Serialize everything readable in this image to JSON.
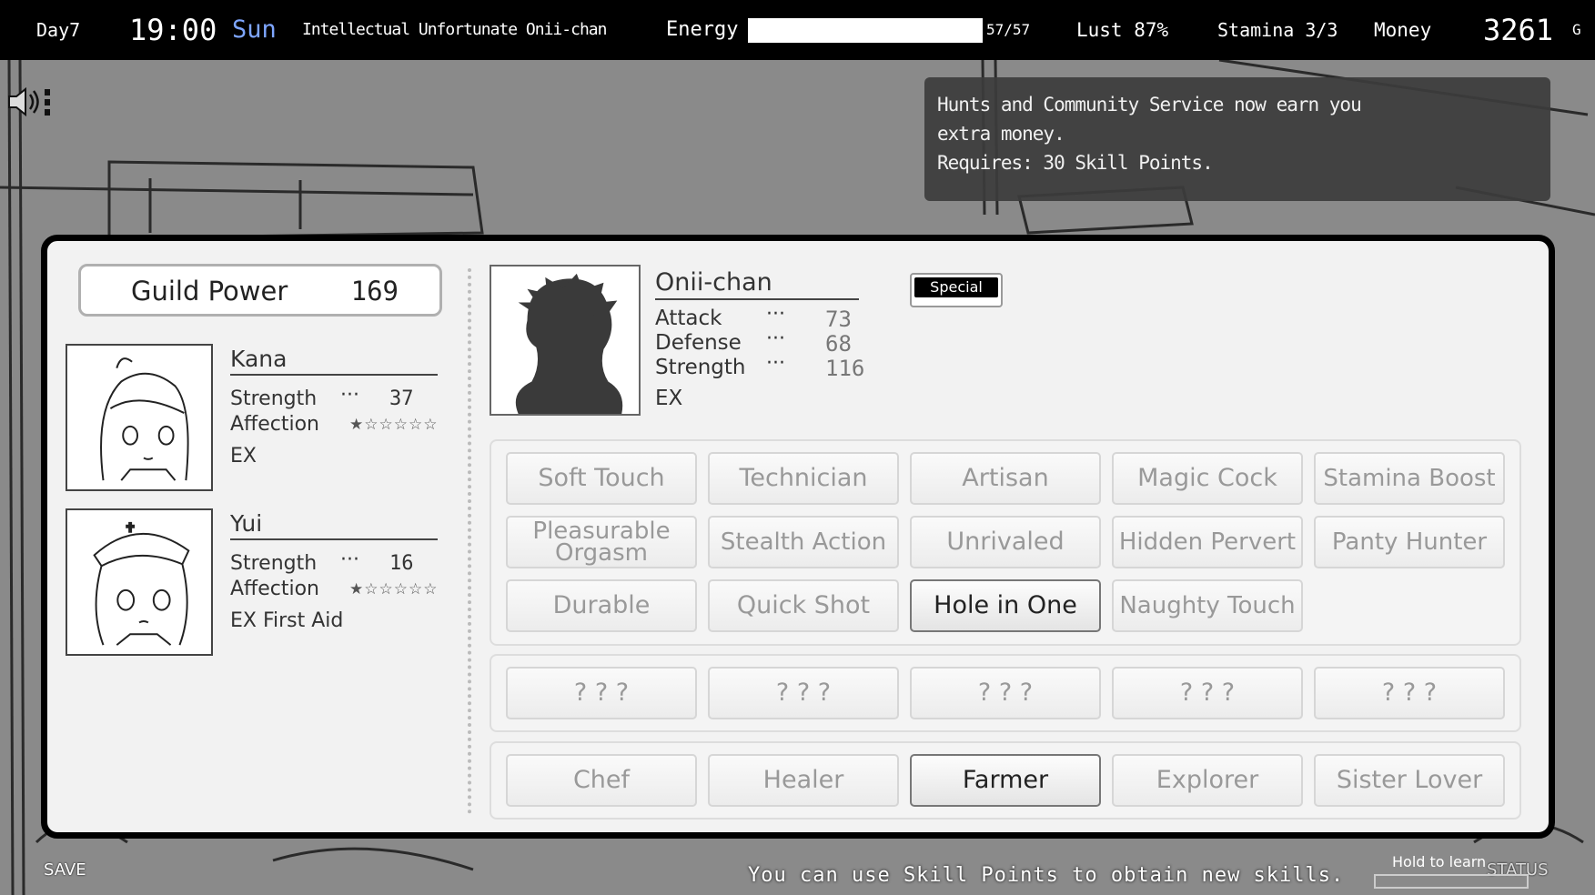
{
  "hud": {
    "day": "Day7",
    "time": "19:00",
    "weekday": "Sun",
    "title": "Intellectual Unfortunate Onii-chan",
    "energy_label": "Energy",
    "energy_value": "57/57",
    "energy_fraction": 1.0,
    "lust": "Lust 87%",
    "stamina": "Stamina 3/3",
    "money_label": "Money",
    "money_value": "3261",
    "money_unit": "G"
  },
  "tooltip": {
    "line1": "Hunts and Community Service now earn you",
    "line2": "extra money.",
    "line3": "Requires: 30 Skill Points."
  },
  "guild": {
    "label": "Guild Power",
    "value": "169"
  },
  "members": [
    {
      "name": "Kana",
      "strength_label": "Strength",
      "dots": "···",
      "strength": "37",
      "affection_label": "Affection",
      "stars": "★☆☆☆☆☆",
      "ex": "EX"
    },
    {
      "name": "Yui",
      "strength_label": "Strength",
      "dots": "···",
      "strength": "16",
      "affection_label": "Affection",
      "stars": "★☆☆☆☆☆",
      "ex": "EX First Aid"
    }
  ],
  "hero": {
    "name": "Onii-chan",
    "attack_label": "Attack",
    "attack": "73",
    "defense_label": "Defense",
    "defense": "68",
    "strength_label": "Strength",
    "strength": "116",
    "dots": "···",
    "ex": "EX",
    "special_label": "Special"
  },
  "skills": {
    "row1": [
      "Soft Touch",
      "Technician",
      "Artisan",
      "Magic Cock",
      "Stamina Boost"
    ],
    "row2": [
      "Pleasurable Orgasm",
      "Stealth Action",
      "Unrivaled",
      "Hidden Pervert",
      "Panty Hunter"
    ],
    "row3": [
      "Durable",
      "Quick Shot",
      "Hole in One",
      "Naughty Touch"
    ],
    "locked": [
      "? ? ?",
      "? ? ?",
      "? ? ?",
      "? ? ?",
      "? ? ?"
    ],
    "jobs": [
      "Chef",
      "Healer",
      "Farmer",
      "Explorer",
      "Sister Lover"
    ]
  },
  "footer": {
    "hint": "You can use Skill Points to obtain new skills.",
    "hold": "Hold to learn",
    "save": "SAVE",
    "status": "STATUS"
  }
}
